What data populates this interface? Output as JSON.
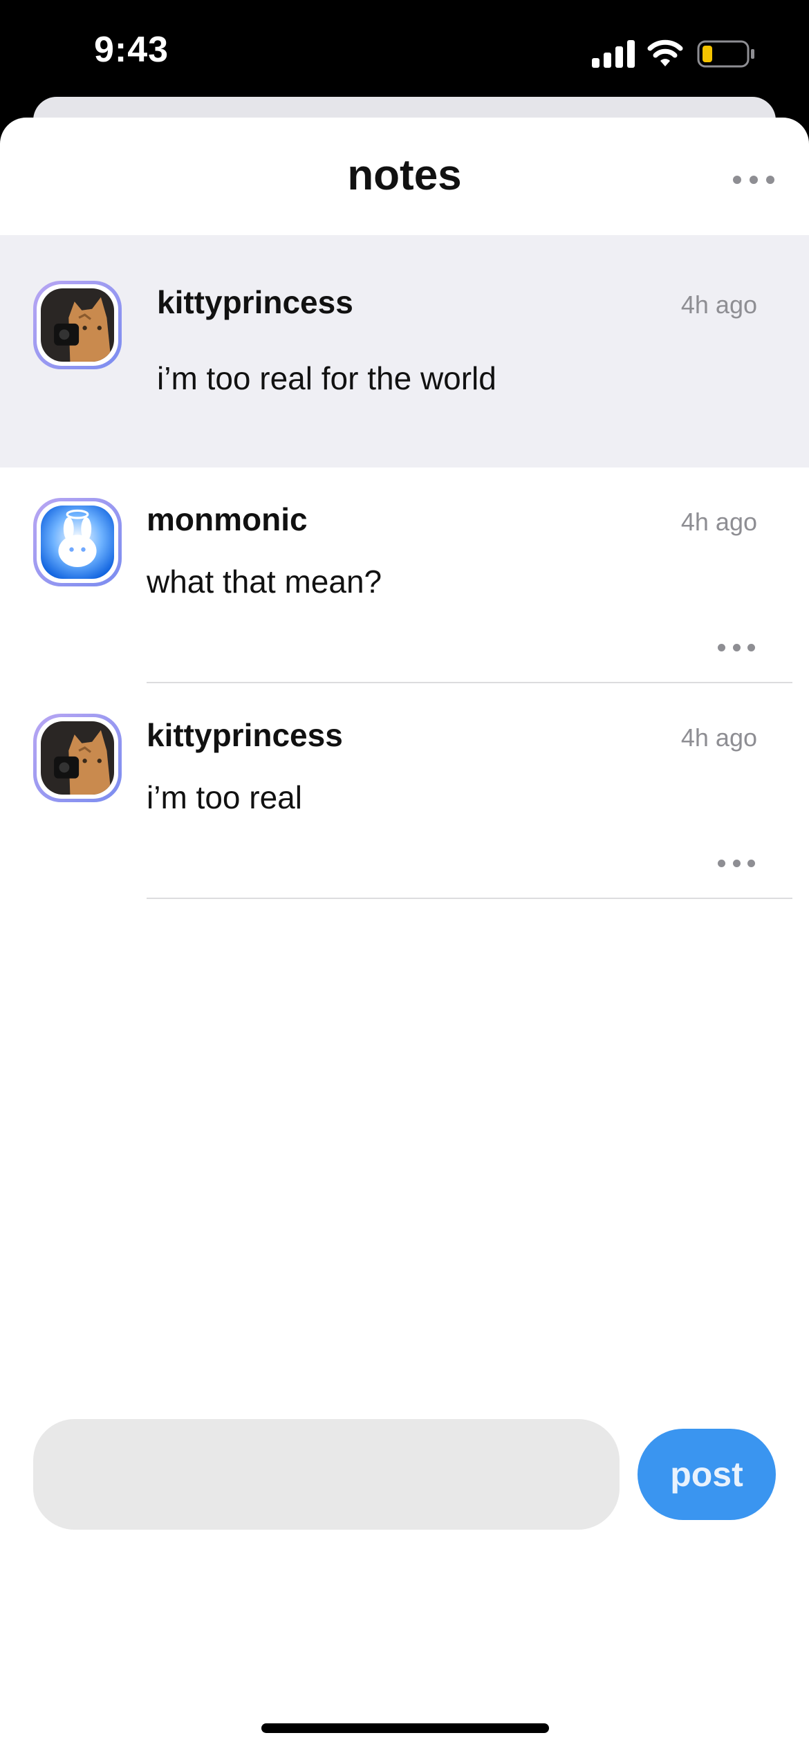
{
  "status_bar": {
    "time": "9:43",
    "icons": [
      "cellular-signal-icon",
      "wifi-icon",
      "battery-low-icon"
    ],
    "battery_color": "#f5c400"
  },
  "header": {
    "title": "notes",
    "more_icon": "more-horizontal-icon"
  },
  "note": {
    "username": "kittyprincess",
    "time": "4h ago",
    "text": "i’m too real for the world",
    "avatar": "cat-photo-avatar"
  },
  "replies": [
    {
      "username": "monmonic",
      "time": "4h ago",
      "text": "what that mean?",
      "avatar": "bunny-avatar",
      "more_icon": "more-horizontal-icon"
    },
    {
      "username": "kittyprincess",
      "time": "4h ago",
      "text": "i’m too real",
      "avatar": "cat-photo-avatar",
      "more_icon": "more-horizontal-icon"
    }
  ],
  "composer": {
    "placeholder": "",
    "value": "",
    "post_label": "post"
  },
  "colors": {
    "accent": "#3a95f0",
    "highlight_bg": "#efeff4",
    "avatar_ring": "#9a8df0",
    "muted_text": "#8e8e93"
  }
}
